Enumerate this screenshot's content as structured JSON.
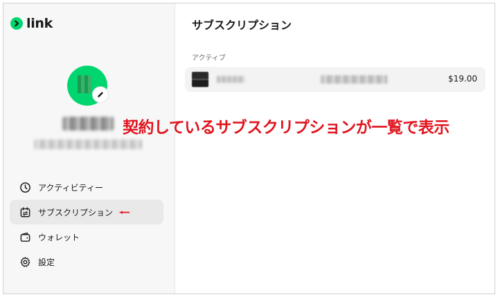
{
  "brand": {
    "name": "link",
    "color": "#00d66f"
  },
  "sidebar": {
    "items": [
      {
        "id": "activity",
        "label": "アクティビティー",
        "icon": "clock-icon"
      },
      {
        "id": "subscriptions",
        "label": "サブスクリプション",
        "icon": "repeat-calendar-icon",
        "active": true
      },
      {
        "id": "wallet",
        "label": "ウォレット",
        "icon": "wallet-icon"
      },
      {
        "id": "settings",
        "label": "設定",
        "icon": "gear-icon"
      }
    ]
  },
  "main": {
    "title": "サブスクリプション",
    "section_label": "アクティブ",
    "subscriptions": [
      {
        "price": "$19.00"
      }
    ]
  },
  "annotation": {
    "text": "契約しているサブスクリプションが一覧で表示",
    "color": "#e0141e"
  }
}
